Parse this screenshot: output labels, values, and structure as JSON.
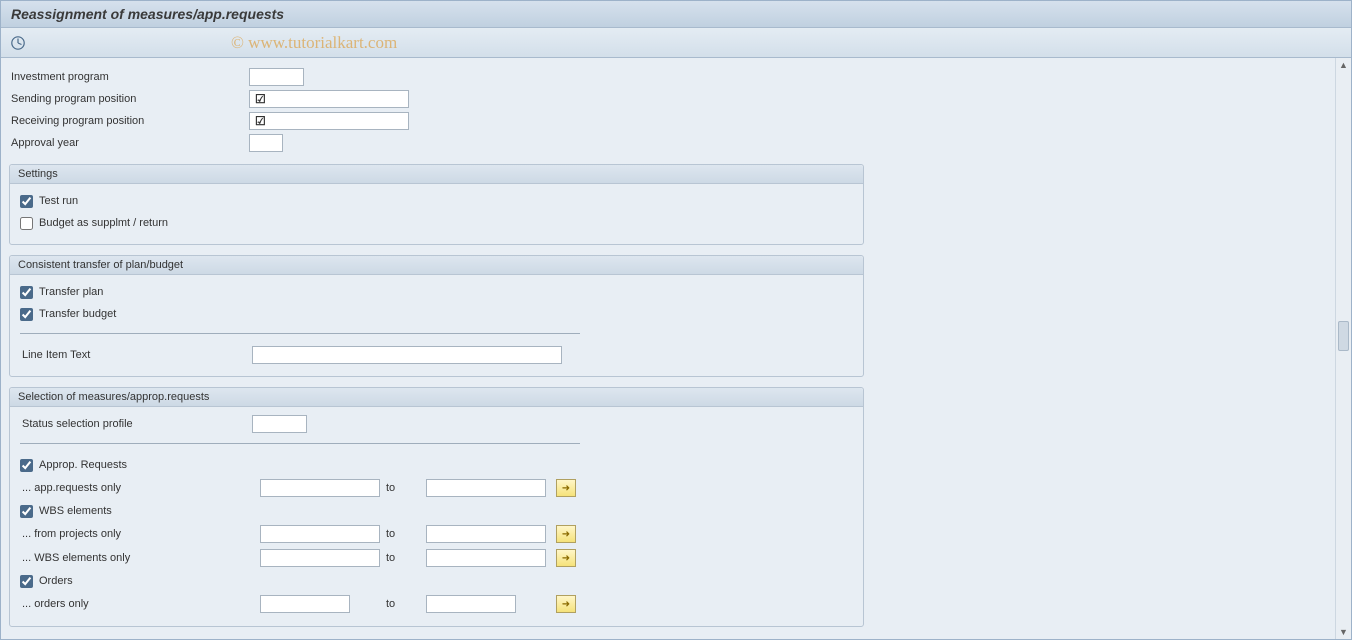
{
  "title": "Reassignment of measures/app.requests",
  "watermark": "© www.tutorialkart.com",
  "top_fields": {
    "investment_program": {
      "label": "Investment program",
      "value": ""
    },
    "sending_position": {
      "label": "Sending program position",
      "value": ""
    },
    "receiving_position": {
      "label": "Receiving program position",
      "value": ""
    },
    "approval_year": {
      "label": "Approval year",
      "value": ""
    }
  },
  "groups": {
    "settings": {
      "title": "Settings",
      "test_run": {
        "label": "Test run",
        "checked": true
      },
      "budget_supplmt": {
        "label": "Budget as supplmt / return",
        "checked": false
      }
    },
    "transfer": {
      "title": "Consistent transfer of plan/budget",
      "transfer_plan": {
        "label": "Transfer plan",
        "checked": true
      },
      "transfer_budget": {
        "label": "Transfer budget",
        "checked": true
      },
      "line_item_text": {
        "label": "Line Item Text",
        "value": ""
      }
    },
    "selection": {
      "title": "Selection of measures/approp.requests",
      "status_profile": {
        "label": "Status selection profile",
        "value": ""
      },
      "approp_requests": {
        "label": "Approp. Requests",
        "checked": true
      },
      "app_requests_only": {
        "label": "... app.requests only",
        "from": "",
        "to": ""
      },
      "wbs_elements": {
        "label": "WBS elements",
        "checked": true
      },
      "from_projects_only": {
        "label": "... from projects only",
        "from": "",
        "to": ""
      },
      "wbs_elements_only": {
        "label": "... WBS elements only",
        "from": "",
        "to": ""
      },
      "orders": {
        "label": "Orders",
        "checked": true
      },
      "orders_only": {
        "label": "... orders only",
        "from": "",
        "to": ""
      },
      "to_label": "to"
    }
  }
}
